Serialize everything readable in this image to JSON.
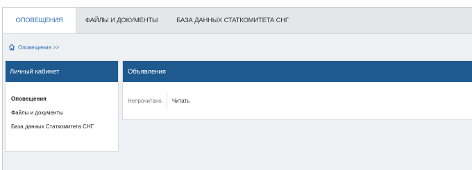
{
  "nav": {
    "tabs": [
      {
        "label": "Оповещения",
        "active": true
      },
      {
        "label": "Файлы и документы",
        "active": false
      },
      {
        "label": "База данных Статкомитета СНГ",
        "active": false
      }
    ]
  },
  "breadcrumb": {
    "icon": "home-icon",
    "label": "Оповещения >>"
  },
  "sidebar": {
    "title": "Личный кабинет",
    "items": [
      {
        "label": "Оповещения",
        "active": true
      },
      {
        "label": "Файлы и документы",
        "active": false
      },
      {
        "label": "База данных Статкомитета СНГ",
        "active": false
      }
    ]
  },
  "main": {
    "title": "Объявления",
    "actions": [
      {
        "label": "Непрочитано"
      },
      {
        "label": "Читать"
      }
    ]
  },
  "colors": {
    "header_blue": "#1e5a8f",
    "link_blue": "#2e6fb3",
    "background": "#eef1f4"
  }
}
